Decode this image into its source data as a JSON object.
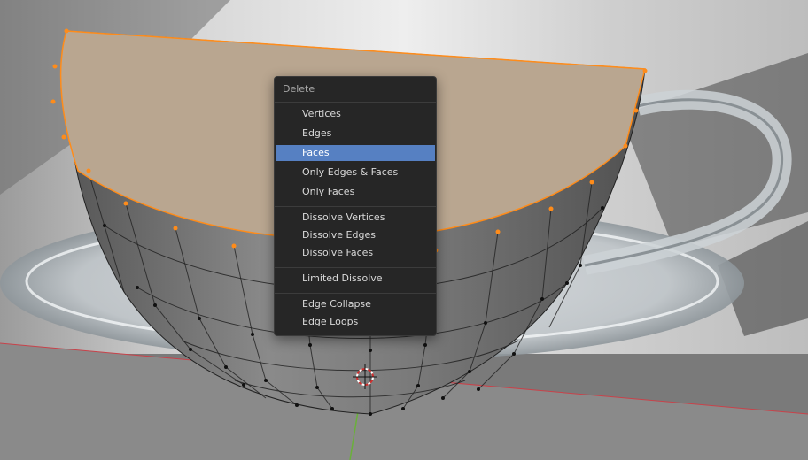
{
  "menu": {
    "title": "Delete",
    "active_index": 2,
    "groups": [
      [
        "Vertices",
        "Edges",
        "Faces",
        "Only Edges & Faces",
        "Only Faces"
      ],
      [
        "Dissolve Vertices",
        "Dissolve Edges",
        "Dissolve Faces"
      ],
      [
        "Limited Dissolve"
      ],
      [
        "Edge Collapse",
        "Edge Loops"
      ]
    ]
  },
  "colors": {
    "menu_bg": "#262626",
    "highlight": "#5680c2",
    "selected_vertex": "#ff8c1a",
    "face_fill": "#b9a690",
    "x_axis": "#c8424a",
    "y_axis": "#6ab03a"
  }
}
